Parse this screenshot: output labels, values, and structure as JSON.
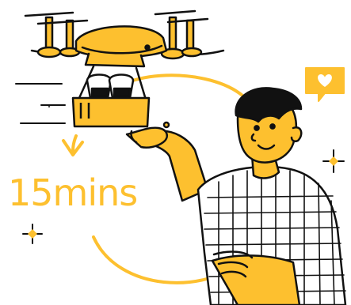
{
  "delivery_time": "15mins",
  "icons": [
    "drone-icon",
    "heart-chat-bubble-icon",
    "sparkle-icon",
    "delivery-person-icon",
    "package-icon"
  ],
  "colors": {
    "accent": "#FDC02F",
    "ink": "#111111",
    "background": "#FFFFFF"
  }
}
